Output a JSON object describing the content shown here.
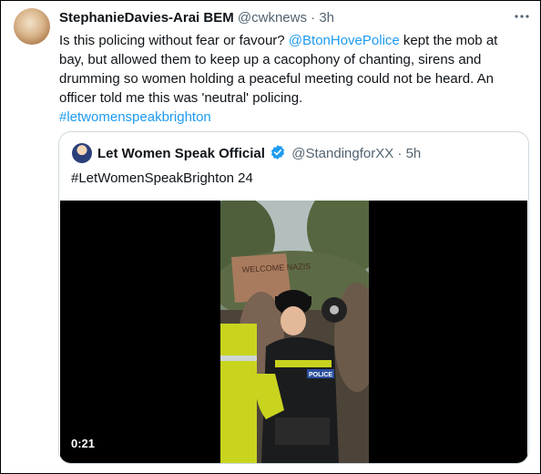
{
  "tweet": {
    "author_name": "StephanieDavies-Arai BEM",
    "author_handle": "@cwknews",
    "separator": "·",
    "time": "3h",
    "more_icon": "more-horizontal-icon",
    "text_before_mention": "Is this policing without fear or favour? ",
    "mention": "@BtonHovePolice",
    "text_after_mention": " kept the mob at bay, but allowed them to keep up a cacophony of chanting, sirens and drumming so women holding a peaceful meeting could not be heard. An officer told me this was 'neutral' policing.",
    "hashtag": "#letwomenspeakbrighton"
  },
  "quoted": {
    "author_name": "Let Women Speak Official",
    "verified_icon": "verified-badge-icon",
    "author_handle": "@StandingforXX",
    "separator": "·",
    "time": "5h",
    "text": "#LetWomenSpeakBrighton 24",
    "video": {
      "duration": "0:21",
      "placard_text": "WELCOME NAZIS",
      "police_label": "POLICE"
    }
  },
  "colors": {
    "link": "#1d9bf0",
    "muted": "#536471",
    "border": "#cfd9de",
    "hi_vis": "#d4e21f"
  }
}
